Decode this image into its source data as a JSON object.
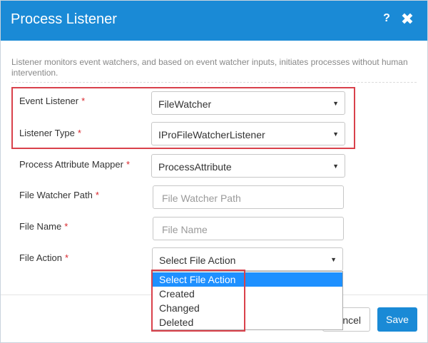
{
  "dialog": {
    "title": "Process Listener",
    "help_label": "?",
    "close_label": "✖",
    "description": "Listener monitors event watchers, and based on event watcher inputs, initiates processes without human intervention."
  },
  "form": {
    "required_marker": "*",
    "event_listener": {
      "label": "Event Listener",
      "value": "FileWatcher"
    },
    "listener_type": {
      "label": "Listener Type",
      "value": "IProFileWatcherListener"
    },
    "process_attribute_mapper": {
      "label": "Process Attribute Mapper",
      "value": "ProcessAttribute"
    },
    "file_watcher_path": {
      "label": "File Watcher Path",
      "placeholder": "File Watcher Path"
    },
    "file_name": {
      "label": "File Name",
      "placeholder": "File Name"
    },
    "file_action": {
      "label": "File Action",
      "value": "Select File Action",
      "options": [
        "Select File Action",
        "Created",
        "Changed",
        "Deleted"
      ],
      "highlighted_option": "Select File Action"
    }
  },
  "footer": {
    "cancel_label": "ncel",
    "save_label": "Save"
  },
  "colors": {
    "header_bg": "#1a8ad6",
    "required": "#d9262c",
    "highlight_box": "#d9414b",
    "option_highlight": "#1e90ff"
  },
  "icons": {
    "help": "help-icon",
    "close": "close-icon",
    "dropdown_arrow": "caret-down-icon"
  }
}
